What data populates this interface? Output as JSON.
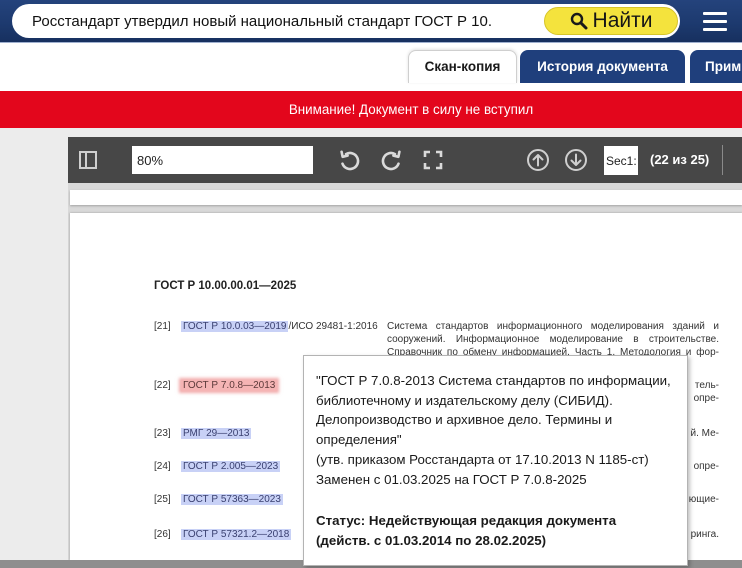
{
  "colors": {
    "header_bg": "#1d3a6f",
    "search_button_bg": "#f4e33d",
    "tab_bg": "#1f3f7c",
    "alert_bg": "#e3061c",
    "toolbar_bg": "#474747",
    "highlight": "#c8d1f6",
    "highlight_active": "#f5b4b4"
  },
  "header": {
    "search": {
      "value": "Росстандарт утвердил новый национальный стандарт ГОСТ Р 10.",
      "button_label": "Найти",
      "button_icon": "search-icon"
    },
    "menu_icon": "hamburger-icon"
  },
  "tabs": [
    {
      "label": "Скан-копия",
      "active": true
    },
    {
      "label": "История документа",
      "active": false
    },
    {
      "label": "Прим",
      "active": false
    }
  ],
  "alert": {
    "text": "Внимание! Документ в силу не вступил"
  },
  "viewer": {
    "toolbar": {
      "sidebar_icon": "sidebar-toggle-icon",
      "zoom": "80%",
      "rotate_left_icon": "rotate-ccw-icon",
      "rotate_right_icon": "rotate-cw-icon",
      "fullscreen_icon": "fullscreen-icon",
      "prev_icon": "arrow-up-circle-icon",
      "next_icon": "arrow-down-circle-icon",
      "section": "Sec1:",
      "page_counter": "(22 из 25)"
    },
    "page": {
      "heading": "ГОСТ Р 10.00.00.01—2025",
      "references": [
        {
          "num": "[21]",
          "code": "ГОСТ Р 10.0.03—2019",
          "suffix": "/ИСО 29481-1:2016",
          "hovered": false,
          "description_lines": [
            "Система стандартов информационного моделирования зданий и",
            "сооружений. Информационное моделирование в строительстве.",
            "Справочник по обмену информацией. Часть 1. Методология и фор-"
          ]
        },
        {
          "num": "[22]",
          "code": "ГОСТ Р 7.0.8—2013",
          "hovered": true,
          "description_lines": [
            "тель-",
            "опре-"
          ]
        },
        {
          "num": "[23]",
          "code": "РМГ 29—2013",
          "hovered": false,
          "description_lines": [
            "й. Ме-"
          ]
        },
        {
          "num": "[24]",
          "code": "ГОСТ Р 2.005—2023",
          "hovered": false,
          "description_lines": [
            "опре-"
          ]
        },
        {
          "num": "[25]",
          "code": "ГОСТ Р 57363—2023",
          "hovered": false,
          "description_lines": [
            "ющие-"
          ]
        },
        {
          "num": "[26]",
          "code": "ГОСТ Р 57321.2—2018",
          "hovered": false,
          "description_lines": [
            "ринга."
          ]
        }
      ]
    }
  },
  "tooltip": {
    "title_lines": [
      "\"ГОСТ Р 7.0.8-2013 Система стандартов по информации,",
      "библиотечному и издательскому делу (СИБИД).",
      "Делопроизводство и архивное дело. Термины и",
      "определения\""
    ],
    "approval": "(утв. приказом Росстандарта от 17.10.2013 N 1185-ст)",
    "replaced": "Заменен с 01.03.2025 на ГОСТ Р 7.0.8-2025",
    "status_lines": [
      "Статус: Недействующая редакция документа",
      "(действ. с 01.03.2014 по 28.02.2025)"
    ]
  }
}
